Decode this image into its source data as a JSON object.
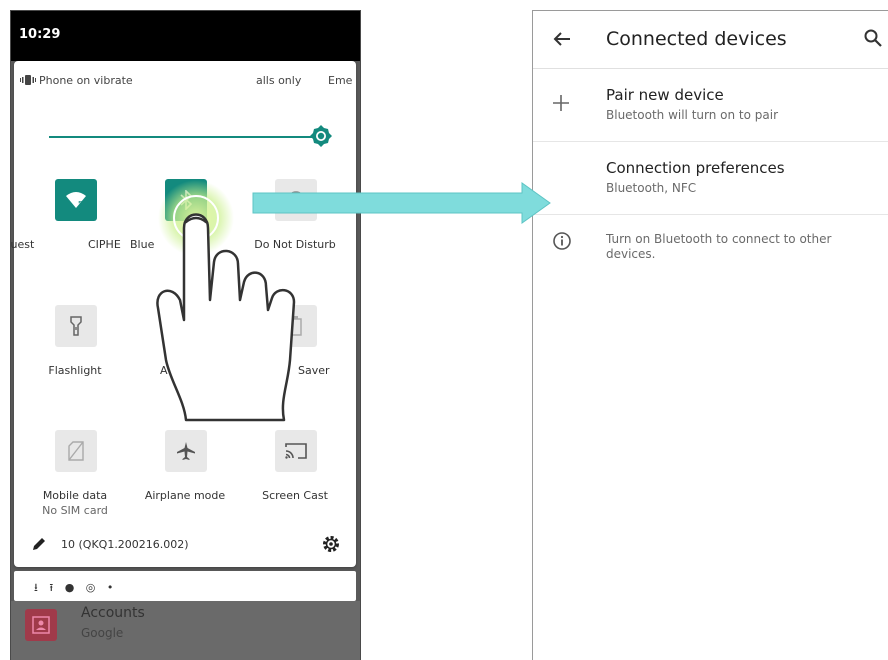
{
  "quick_settings": {
    "time": "10:29",
    "header": {
      "vibrate_label": "Phone on vibrate",
      "calls_label": "alls only",
      "emergency_label": "Eme"
    },
    "brightness_level": 1.0,
    "tiles": [
      {
        "label": "Guest",
        "label2": "CIPHE",
        "state": "on",
        "icon": "wifi-icon"
      },
      {
        "label": "Blue",
        "state": "on",
        "icon": "bluetooth-icon"
      },
      {
        "label": "Do Not Disturb",
        "state": "off",
        "icon": "do-not-disturb-icon"
      },
      {
        "label": "Flashlight",
        "state": "off",
        "icon": "flashlight-icon"
      },
      {
        "label": "A",
        "state": "off",
        "icon": "auto-rotate-icon"
      },
      {
        "label": "Saver",
        "state": "off",
        "icon": "battery-saver-icon"
      },
      {
        "label": "Mobile data",
        "sub": "No SIM card",
        "state": "off",
        "icon": "mobile-data-icon"
      },
      {
        "label": "Airplane mode",
        "state": "off",
        "icon": "airplane-icon"
      },
      {
        "label": "Screen Cast",
        "state": "off",
        "icon": "cast-icon"
      }
    ],
    "build_number": "10 (QKQ1.200216.002)",
    "notification_icons": "⭳ ⭱ ● ◎ •",
    "background_app": {
      "title": "Accounts",
      "subtitle": "Google"
    }
  },
  "connected_devices": {
    "title": "Connected devices",
    "pair_new_device": {
      "title": "Pair new device",
      "subtitle": "Bluetooth will turn on to pair"
    },
    "connection_preferences": {
      "title": "Connection preferences",
      "subtitle": "Bluetooth, NFC"
    },
    "info_text": "Turn on Bluetooth to connect to other devices."
  },
  "colors": {
    "accent": "#138a7e",
    "arrow": "#7fdcdc",
    "tap_glow": "#c9f08a"
  }
}
